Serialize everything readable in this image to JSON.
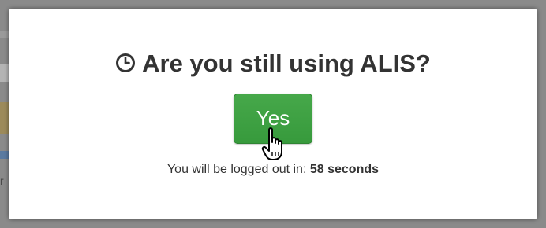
{
  "dialog": {
    "title": "Are you still using ALIS?",
    "title_icon": "clock-icon",
    "yes_button_label": "Yes",
    "logout_prefix": "You will be logged out in:",
    "countdown": "58 seconds"
  },
  "background": {
    "partial_text": "r"
  },
  "colors": {
    "yes_button": "#3c9f40",
    "title_text": "#333333",
    "modal_background": "#ffffff",
    "overlay": "#8a8a8a"
  }
}
